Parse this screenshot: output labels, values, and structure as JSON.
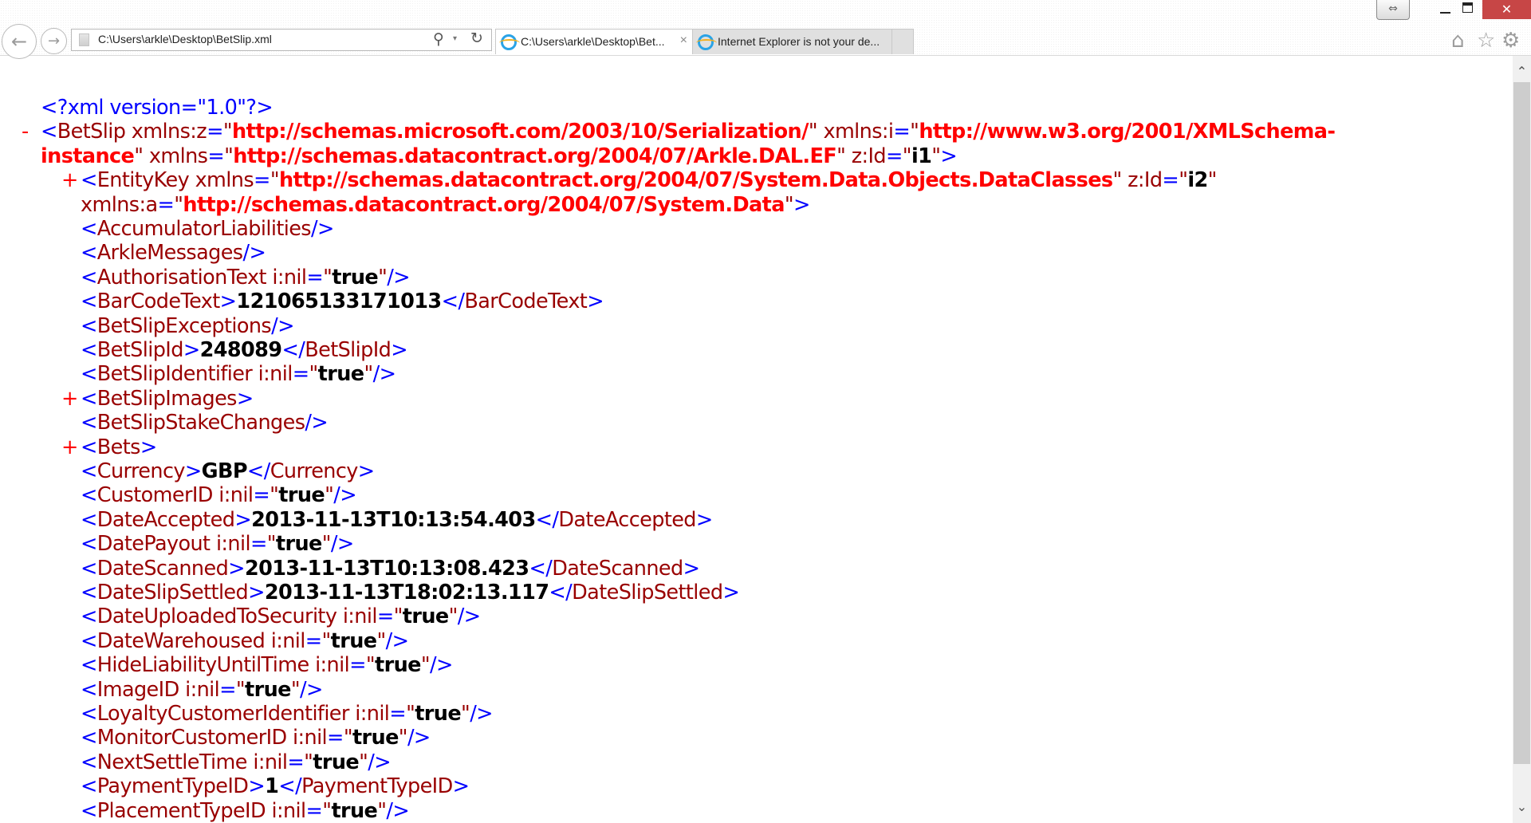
{
  "browser": {
    "address": "C:\\Users\\arkle\\Desktop\\BetSlip.xml",
    "tabs": [
      {
        "label": "C:\\Users\\arkle\\Desktop\\Bet...",
        "active": true
      },
      {
        "label": "Internet Explorer is not your de...",
        "active": false
      }
    ],
    "icons": {
      "back": "←",
      "forward": "→",
      "search": "⚲",
      "dropdown": "▾",
      "refresh": "↻",
      "tab_close": "×",
      "restore_left": "⇔",
      "close": "✕",
      "home": "⌂",
      "favorites": "☆",
      "tools": "⚙",
      "scroll_up": "⌃",
      "scroll_down": "⌄"
    }
  },
  "xml": {
    "markers": {
      "collapse": "-",
      "expand": "+"
    },
    "lines": [
      {
        "indent": 0,
        "marker": "",
        "tokens": [
          [
            "p",
            "<?"
          ],
          [
            "p",
            "xml version=\"1.0\""
          ],
          [
            "p",
            "?>"
          ]
        ]
      },
      {
        "indent": 0,
        "marker": "-",
        "tokens": [
          [
            "p",
            "<"
          ],
          [
            "n",
            "BetSlip xmlns:z"
          ],
          [
            "p",
            "="
          ],
          [
            "n",
            "\""
          ],
          [
            "v",
            "http://schemas.microsoft.com/2003/10/Serialization/"
          ],
          [
            "n",
            "\" xmlns:i"
          ],
          [
            "p",
            "="
          ],
          [
            "n",
            "\""
          ],
          [
            "v",
            "http://www.w3.org/2001/XMLSchema-"
          ]
        ]
      },
      {
        "indent": 0,
        "marker": "",
        "tokens": [
          [
            "v",
            "instance"
          ],
          [
            "n",
            "\" xmlns"
          ],
          [
            "p",
            "="
          ],
          [
            "n",
            "\""
          ],
          [
            "v",
            "http://schemas.datacontract.org/2004/07/Arkle.DAL.EF"
          ],
          [
            "n",
            "\" z:Id"
          ],
          [
            "p",
            "="
          ],
          [
            "n",
            "\""
          ],
          [
            "b",
            "i1"
          ],
          [
            "n",
            "\""
          ],
          [
            "p",
            ">"
          ]
        ]
      },
      {
        "indent": 1,
        "marker": "+",
        "tokens": [
          [
            "p",
            "<"
          ],
          [
            "n",
            "EntityKey xmlns"
          ],
          [
            "p",
            "="
          ],
          [
            "n",
            "\""
          ],
          [
            "v",
            "http://schemas.datacontract.org/2004/07/System.Data.Objects.DataClasses"
          ],
          [
            "n",
            "\" z:Id"
          ],
          [
            "p",
            "="
          ],
          [
            "n",
            "\""
          ],
          [
            "b",
            "i2"
          ],
          [
            "n",
            "\""
          ]
        ]
      },
      {
        "indent": 1,
        "marker": "",
        "tokens": [
          [
            "n",
            "xmlns:a"
          ],
          [
            "p",
            "="
          ],
          [
            "n",
            "\""
          ],
          [
            "v",
            "http://schemas.datacontract.org/2004/07/System.Data"
          ],
          [
            "n",
            "\""
          ],
          [
            "p",
            ">"
          ]
        ]
      },
      {
        "indent": 1,
        "marker": "",
        "tokens": [
          [
            "p",
            "<"
          ],
          [
            "n",
            "AccumulatorLiabilities"
          ],
          [
            "p",
            "/>"
          ]
        ]
      },
      {
        "indent": 1,
        "marker": "",
        "tokens": [
          [
            "p",
            "<"
          ],
          [
            "n",
            "ArkleMessages"
          ],
          [
            "p",
            "/>"
          ]
        ]
      },
      {
        "indent": 1,
        "marker": "",
        "tokens": [
          [
            "p",
            "<"
          ],
          [
            "n",
            "AuthorisationText i:nil"
          ],
          [
            "p",
            "="
          ],
          [
            "n",
            "\""
          ],
          [
            "b",
            "true"
          ],
          [
            "n",
            "\""
          ],
          [
            "p",
            "/>"
          ]
        ]
      },
      {
        "indent": 1,
        "marker": "",
        "tokens": [
          [
            "p",
            "<"
          ],
          [
            "n",
            "BarCodeText"
          ],
          [
            "p",
            ">"
          ],
          [
            "b",
            "121065133171013"
          ],
          [
            "p",
            "</"
          ],
          [
            "n",
            "BarCodeText"
          ],
          [
            "p",
            ">"
          ]
        ]
      },
      {
        "indent": 1,
        "marker": "",
        "tokens": [
          [
            "p",
            "<"
          ],
          [
            "n",
            "BetSlipExceptions"
          ],
          [
            "p",
            "/>"
          ]
        ]
      },
      {
        "indent": 1,
        "marker": "",
        "tokens": [
          [
            "p",
            "<"
          ],
          [
            "n",
            "BetSlipId"
          ],
          [
            "p",
            ">"
          ],
          [
            "b",
            "248089"
          ],
          [
            "p",
            "</"
          ],
          [
            "n",
            "BetSlipId"
          ],
          [
            "p",
            ">"
          ]
        ]
      },
      {
        "indent": 1,
        "marker": "",
        "tokens": [
          [
            "p",
            "<"
          ],
          [
            "n",
            "BetSlipIdentifier i:nil"
          ],
          [
            "p",
            "="
          ],
          [
            "n",
            "\""
          ],
          [
            "b",
            "true"
          ],
          [
            "n",
            "\""
          ],
          [
            "p",
            "/>"
          ]
        ]
      },
      {
        "indent": 1,
        "marker": "+",
        "tokens": [
          [
            "p",
            "<"
          ],
          [
            "n",
            "BetSlipImages"
          ],
          [
            "p",
            ">"
          ]
        ]
      },
      {
        "indent": 1,
        "marker": "",
        "tokens": [
          [
            "p",
            "<"
          ],
          [
            "n",
            "BetSlipStakeChanges"
          ],
          [
            "p",
            "/>"
          ]
        ]
      },
      {
        "indent": 1,
        "marker": "+",
        "tokens": [
          [
            "p",
            "<"
          ],
          [
            "n",
            "Bets"
          ],
          [
            "p",
            ">"
          ]
        ]
      },
      {
        "indent": 1,
        "marker": "",
        "tokens": [
          [
            "p",
            "<"
          ],
          [
            "n",
            "Currency"
          ],
          [
            "p",
            ">"
          ],
          [
            "b",
            "GBP"
          ],
          [
            "p",
            "</"
          ],
          [
            "n",
            "Currency"
          ],
          [
            "p",
            ">"
          ]
        ]
      },
      {
        "indent": 1,
        "marker": "",
        "tokens": [
          [
            "p",
            "<"
          ],
          [
            "n",
            "CustomerID i:nil"
          ],
          [
            "p",
            "="
          ],
          [
            "n",
            "\""
          ],
          [
            "b",
            "true"
          ],
          [
            "n",
            "\""
          ],
          [
            "p",
            "/>"
          ]
        ]
      },
      {
        "indent": 1,
        "marker": "",
        "tokens": [
          [
            "p",
            "<"
          ],
          [
            "n",
            "DateAccepted"
          ],
          [
            "p",
            ">"
          ],
          [
            "b",
            "2013-11-13T10:13:54.403"
          ],
          [
            "p",
            "</"
          ],
          [
            "n",
            "DateAccepted"
          ],
          [
            "p",
            ">"
          ]
        ]
      },
      {
        "indent": 1,
        "marker": "",
        "tokens": [
          [
            "p",
            "<"
          ],
          [
            "n",
            "DatePayout i:nil"
          ],
          [
            "p",
            "="
          ],
          [
            "n",
            "\""
          ],
          [
            "b",
            "true"
          ],
          [
            "n",
            "\""
          ],
          [
            "p",
            "/>"
          ]
        ]
      },
      {
        "indent": 1,
        "marker": "",
        "tokens": [
          [
            "p",
            "<"
          ],
          [
            "n",
            "DateScanned"
          ],
          [
            "p",
            ">"
          ],
          [
            "b",
            "2013-11-13T10:13:08.423"
          ],
          [
            "p",
            "</"
          ],
          [
            "n",
            "DateScanned"
          ],
          [
            "p",
            ">"
          ]
        ]
      },
      {
        "indent": 1,
        "marker": "",
        "tokens": [
          [
            "p",
            "<"
          ],
          [
            "n",
            "DateSlipSettled"
          ],
          [
            "p",
            ">"
          ],
          [
            "b",
            "2013-11-13T18:02:13.117"
          ],
          [
            "p",
            "</"
          ],
          [
            "n",
            "DateSlipSettled"
          ],
          [
            "p",
            ">"
          ]
        ]
      },
      {
        "indent": 1,
        "marker": "",
        "tokens": [
          [
            "p",
            "<"
          ],
          [
            "n",
            "DateUploadedToSecurity i:nil"
          ],
          [
            "p",
            "="
          ],
          [
            "n",
            "\""
          ],
          [
            "b",
            "true"
          ],
          [
            "n",
            "\""
          ],
          [
            "p",
            "/>"
          ]
        ]
      },
      {
        "indent": 1,
        "marker": "",
        "tokens": [
          [
            "p",
            "<"
          ],
          [
            "n",
            "DateWarehoused i:nil"
          ],
          [
            "p",
            "="
          ],
          [
            "n",
            "\""
          ],
          [
            "b",
            "true"
          ],
          [
            "n",
            "\""
          ],
          [
            "p",
            "/>"
          ]
        ]
      },
      {
        "indent": 1,
        "marker": "",
        "tokens": [
          [
            "p",
            "<"
          ],
          [
            "n",
            "HideLiabilityUntilTime i:nil"
          ],
          [
            "p",
            "="
          ],
          [
            "n",
            "\""
          ],
          [
            "b",
            "true"
          ],
          [
            "n",
            "\""
          ],
          [
            "p",
            "/>"
          ]
        ]
      },
      {
        "indent": 1,
        "marker": "",
        "tokens": [
          [
            "p",
            "<"
          ],
          [
            "n",
            "ImageID i:nil"
          ],
          [
            "p",
            "="
          ],
          [
            "n",
            "\""
          ],
          [
            "b",
            "true"
          ],
          [
            "n",
            "\""
          ],
          [
            "p",
            "/>"
          ]
        ]
      },
      {
        "indent": 1,
        "marker": "",
        "tokens": [
          [
            "p",
            "<"
          ],
          [
            "n",
            "LoyaltyCustomerIdentifier i:nil"
          ],
          [
            "p",
            "="
          ],
          [
            "n",
            "\""
          ],
          [
            "b",
            "true"
          ],
          [
            "n",
            "\""
          ],
          [
            "p",
            "/>"
          ]
        ]
      },
      {
        "indent": 1,
        "marker": "",
        "tokens": [
          [
            "p",
            "<"
          ],
          [
            "n",
            "MonitorCustomerID i:nil"
          ],
          [
            "p",
            "="
          ],
          [
            "n",
            "\""
          ],
          [
            "b",
            "true"
          ],
          [
            "n",
            "\""
          ],
          [
            "p",
            "/>"
          ]
        ]
      },
      {
        "indent": 1,
        "marker": "",
        "tokens": [
          [
            "p",
            "<"
          ],
          [
            "n",
            "NextSettleTime i:nil"
          ],
          [
            "p",
            "="
          ],
          [
            "n",
            "\""
          ],
          [
            "b",
            "true"
          ],
          [
            "n",
            "\""
          ],
          [
            "p",
            "/>"
          ]
        ]
      },
      {
        "indent": 1,
        "marker": "",
        "tokens": [
          [
            "p",
            "<"
          ],
          [
            "n",
            "PaymentTypeID"
          ],
          [
            "p",
            ">"
          ],
          [
            "b",
            "1"
          ],
          [
            "p",
            "</"
          ],
          [
            "n",
            "PaymentTypeID"
          ],
          [
            "p",
            ">"
          ]
        ]
      },
      {
        "indent": 1,
        "marker": "",
        "tokens": [
          [
            "p",
            "<"
          ],
          [
            "n",
            "PlacementTypeID i:nil"
          ],
          [
            "p",
            "="
          ],
          [
            "n",
            "\""
          ],
          [
            "b",
            "true"
          ],
          [
            "n",
            "\""
          ],
          [
            "p",
            "/>"
          ]
        ]
      }
    ]
  }
}
